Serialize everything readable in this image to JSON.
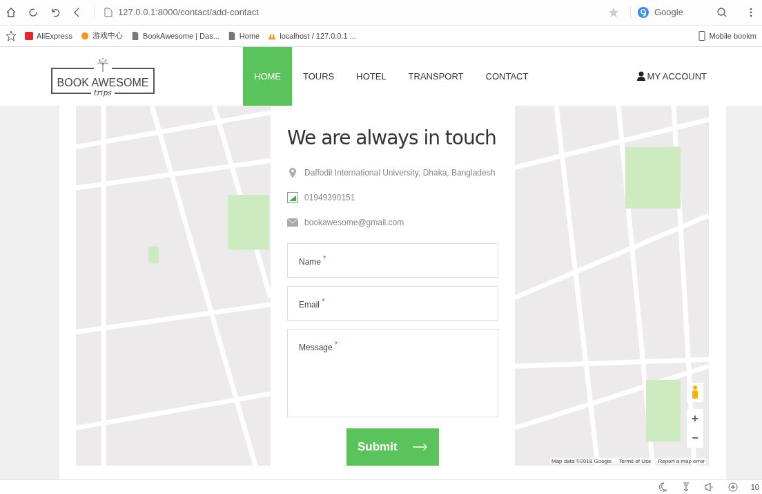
{
  "browser": {
    "address": "127.0.0.1:8000/contact/add-contact",
    "search_engine": "Google",
    "bookmarks": [
      {
        "label": "AliExpress",
        "kind": "shop"
      },
      {
        "label": "游戏中心",
        "kind": "game"
      },
      {
        "label": "BookAwesome | Das...",
        "kind": "page"
      },
      {
        "label": "Home",
        "kind": "page"
      },
      {
        "label": "localhost / 127.0.0.1 ...",
        "kind": "pma"
      }
    ],
    "mobile_bookmarks": "Mobile bookm"
  },
  "site": {
    "logo_title": "BOOK AWESOME",
    "logo_subtitle": "trips",
    "nav": [
      {
        "label": "HOME",
        "selected": true
      },
      {
        "label": "TOURS",
        "selected": false
      },
      {
        "label": "HOTEL",
        "selected": false
      },
      {
        "label": "TRANSPORT",
        "selected": false
      },
      {
        "label": "CONTACT",
        "selected": false
      }
    ],
    "account": "MY ACCOUNT"
  },
  "contact": {
    "title": "We are always in touch",
    "info": [
      {
        "kind": "location",
        "text": "Daffodil International University, Dhaka, Bangladesh"
      },
      {
        "kind": "phone",
        "text": "01949390151"
      },
      {
        "kind": "email",
        "text": "bookawesome@gmail.com"
      }
    ],
    "fields": [
      {
        "label": "Name",
        "required_mark": "*",
        "kind": "line"
      },
      {
        "label": "Email",
        "required_mark": "*",
        "kind": "line"
      },
      {
        "label": "Message",
        "required_mark": "*",
        "kind": "area"
      }
    ],
    "submit": "Submit"
  },
  "map": {
    "attribution": [
      "Map data ©2018 Google",
      "Terms of Use",
      "Report a map error"
    ],
    "zoom_in": "+",
    "zoom_out": "−"
  },
  "status_bar": {
    "zoom": "10"
  }
}
